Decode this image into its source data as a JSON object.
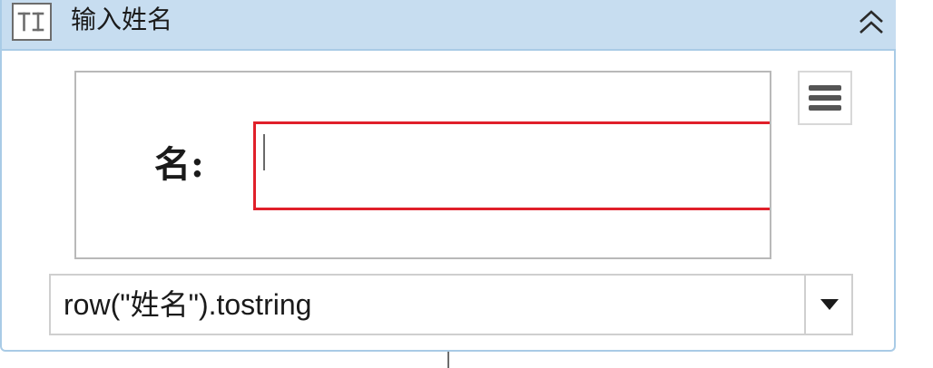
{
  "activity": {
    "type_icon": "text-input-icon",
    "title": "输入姓名",
    "collapse_icon": "double-chevron-up-icon"
  },
  "preview": {
    "field_label": "名:",
    "input_value": "",
    "highlight_color": "#e0202a"
  },
  "menu": {
    "icon": "hamburger-menu-icon"
  },
  "expression": {
    "value": "row(\"姓名\").tostring",
    "dropdown_icon": "caret-down-icon"
  },
  "colors": {
    "header_bg": "#c7ddf0",
    "border": "#a9cbe6"
  }
}
